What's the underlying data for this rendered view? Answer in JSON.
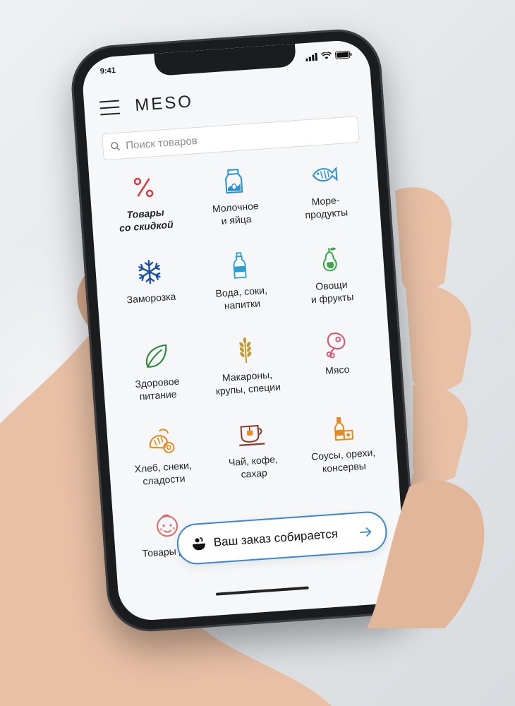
{
  "status_bar": {
    "time": "9:41"
  },
  "header": {
    "brand": "MESO"
  },
  "search": {
    "placeholder": "Поиск товаров"
  },
  "categories": [
    {
      "label": "Товары\nсо скидкой",
      "icon": "percent-icon",
      "color": "#e0303a"
    },
    {
      "label": "Молочное\nи яйца",
      "icon": "milk-carton-icon",
      "color": "#2a8fd6"
    },
    {
      "label": "Море-\nпродукты",
      "icon": "fish-icon",
      "color": "#2a8fd6"
    },
    {
      "label": "Заморозка",
      "icon": "snowflake-icon",
      "color": "#1d4fa8"
    },
    {
      "label": "Вода, соки,\nнапитки",
      "icon": "bottle-icon",
      "color": "#2a9fd6"
    },
    {
      "label": "Овощи\nи фрукты",
      "icon": "pear-icon",
      "color": "#3aa64a"
    },
    {
      "label": "Здоровое\nпитание",
      "icon": "leaf-icon",
      "color": "#2f8a3c"
    },
    {
      "label": "Макароны,\nкрупы, специи",
      "icon": "wheat-icon",
      "color": "#c09a2c"
    },
    {
      "label": "Мясо",
      "icon": "meat-icon",
      "color": "#e0506a"
    },
    {
      "label": "Хлеб, снеки,\nсладости",
      "icon": "bread-icon",
      "color": "#e88a20"
    },
    {
      "label": "Чай, кофе,\nсахар",
      "icon": "tea-cup-icon",
      "color": "#8a3a2a"
    },
    {
      "label": "Соусы, орехи,\nконсервы",
      "icon": "jar-icon",
      "color": "#e88a20"
    },
    {
      "label": "Товары для",
      "icon": "baby-icon",
      "color": "#e06a6a"
    }
  ],
  "order_banner": {
    "text": "Ваш заказ собирается"
  }
}
